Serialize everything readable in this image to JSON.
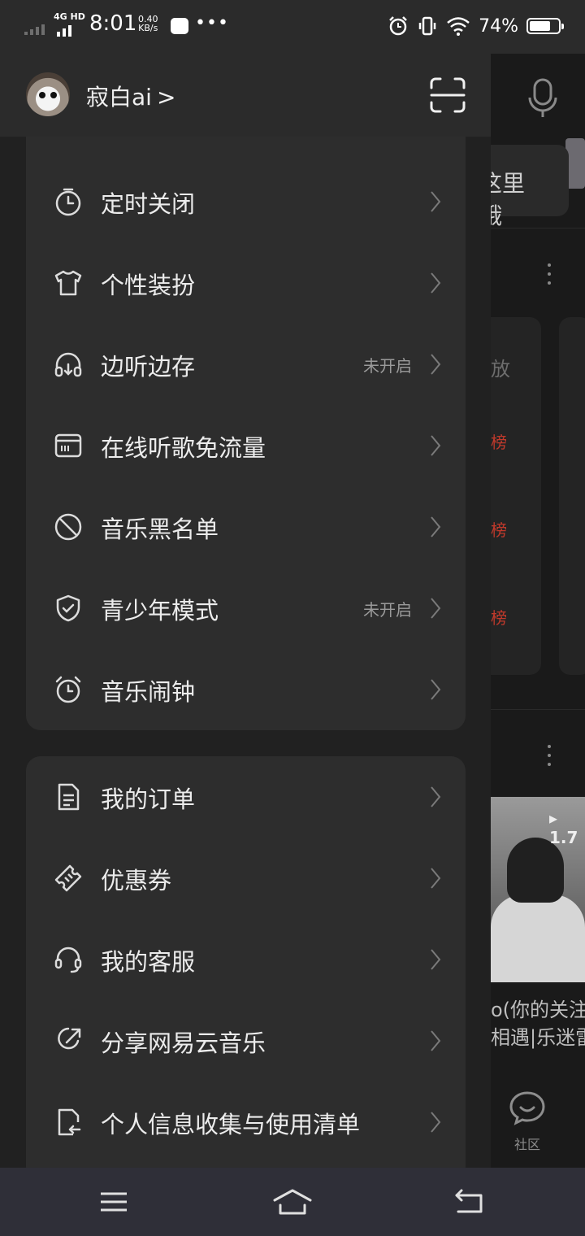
{
  "status_bar": {
    "network": "4G HD",
    "time": "8:01",
    "speed_value": "0.40",
    "speed_unit": "KB/s",
    "more": "•••",
    "battery_percent": "74%",
    "battery_level": 0.74
  },
  "drawer": {
    "header": {
      "username": "寂白ai",
      "chevron": ">"
    },
    "group1": [
      {
        "label": "定时关闭",
        "status": "",
        "icon": "timer-icon"
      },
      {
        "label": "个性装扮",
        "status": "",
        "icon": "tshirt-icon"
      },
      {
        "label": "边听边存",
        "status": "未开启",
        "icon": "headphones-download-icon"
      },
      {
        "label": "在线听歌免流量",
        "status": "",
        "icon": "sim-card-icon"
      },
      {
        "label": "音乐黑名单",
        "status": "",
        "icon": "block-icon"
      },
      {
        "label": "青少年模式",
        "status": "未开启",
        "icon": "shield-check-icon"
      },
      {
        "label": "音乐闹钟",
        "status": "",
        "icon": "alarm-clock-icon"
      }
    ],
    "group2": [
      {
        "label": "我的订单",
        "status": "",
        "icon": "document-icon"
      },
      {
        "label": "优惠券",
        "status": "",
        "icon": "coupon-icon"
      },
      {
        "label": "我的客服",
        "status": "",
        "icon": "headset-icon"
      },
      {
        "label": "分享网易云音乐",
        "status": "",
        "icon": "share-icon"
      },
      {
        "label": "个人信息收集与使用清单",
        "status": "",
        "icon": "file-list-icon"
      }
    ]
  },
  "background": {
    "search_hint": "这里哦",
    "play_label": "放",
    "rank_labels": [
      "榜",
      "榜",
      "榜"
    ],
    "video_playcount": "▸ 1.7",
    "video_title_line1": "o(你的关注",
    "video_title_line2": "相遇|乐迷雷",
    "community_label": "社区"
  }
}
